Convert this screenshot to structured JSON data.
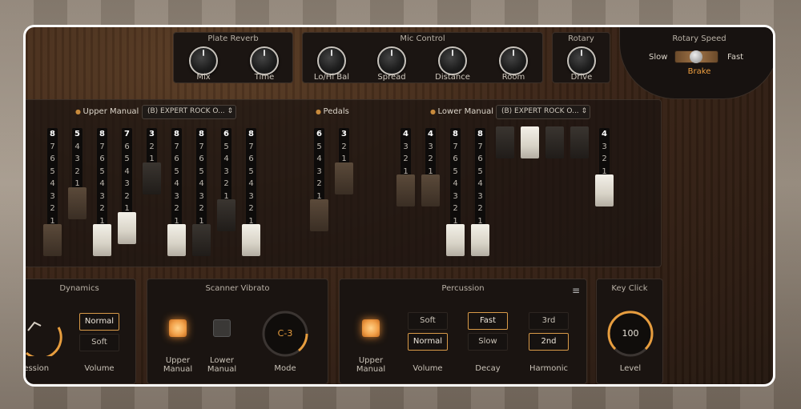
{
  "colors": {
    "accent": "#e79d3e",
    "accent_text": "#f0a040",
    "selected_border": "#d89a48"
  },
  "top": {
    "plate_reverb": {
      "title": "Plate Reverb",
      "knobs": [
        "Mix",
        "Time"
      ]
    },
    "mic_control": {
      "title": "Mic Control",
      "knobs": [
        "Lo/Hi Bal",
        "Spread",
        "Distance",
        "Room"
      ]
    },
    "rotary": {
      "title": "Rotary",
      "knob": "Drive"
    },
    "rotary_speed": {
      "title": "Rotary Speed",
      "slow": "Slow",
      "fast": "Fast",
      "brake": "Brake"
    }
  },
  "drawbars": {
    "upper_label": "Upper Manual",
    "upper_preset": "(B) EXPERT ROCK O...",
    "pedals_label": "Pedals",
    "lower_label": "Lower Manual",
    "lower_preset": "(B) EXPERT ROCK O...",
    "scale_8": [
      "8",
      "7",
      "6",
      "5",
      "4",
      "3",
      "2",
      "1"
    ],
    "scale_7": [
      "7",
      "6",
      "5",
      "4",
      "3",
      "2",
      "1"
    ],
    "scale_6": [
      "6",
      "5",
      "4",
      "3",
      "2",
      "1"
    ],
    "scale_5": [
      "5",
      "4",
      "3",
      "2",
      "1"
    ],
    "scale_4": [
      "4",
      "3",
      "2",
      "1"
    ],
    "scale_3": [
      "3",
      "2",
      "1"
    ]
  },
  "dynamics": {
    "title": "Dynamics",
    "expression_label": "Expression",
    "volume_label": "Volume",
    "volume_options": [
      "Normal",
      "Soft"
    ],
    "volume_selected": "Normal"
  },
  "scanner_vibrato": {
    "title": "Scanner Vibrato",
    "upper_manual": "Upper Manual",
    "lower_manual": "Lower Manual",
    "mode_value": "C-3",
    "mode_label": "Mode"
  },
  "percussion": {
    "title": "Percussion",
    "menu_icon": "hamburger-icon",
    "upper_manual": "Upper Manual",
    "volume_label": "Volume",
    "volume_options": [
      "Soft",
      "Normal"
    ],
    "volume_selected": "Normal",
    "decay_label": "Decay",
    "decay_options": [
      "Fast",
      "Slow"
    ],
    "decay_selected": "Fast",
    "harmonic_label": "Harmonic",
    "harmonic_options": [
      "3rd",
      "2nd"
    ],
    "harmonic_selected": "2nd"
  },
  "key_click": {
    "title": "Key Click",
    "value": "100",
    "level_label": "Level"
  }
}
